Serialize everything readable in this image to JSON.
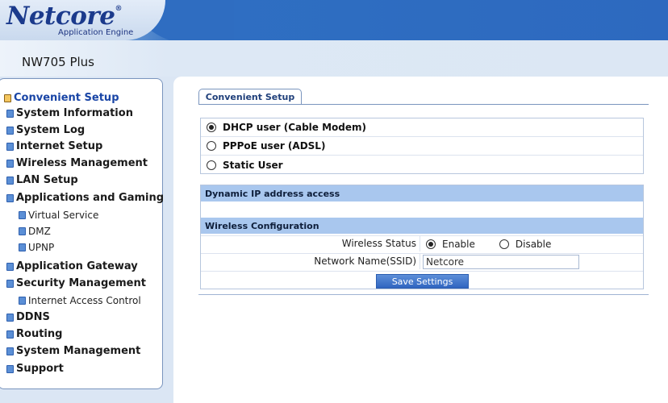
{
  "header": {
    "brand": "Netcore",
    "brand_mark": "®",
    "tagline": "Application Engine"
  },
  "device": {
    "name": "NW705 Plus"
  },
  "sidebar": {
    "items": [
      {
        "label": "Convenient Setup",
        "active": true
      },
      {
        "label": "System Information"
      },
      {
        "label": "System Log"
      },
      {
        "label": "Internet Setup"
      },
      {
        "label": "Wireless Management"
      },
      {
        "label": "LAN Setup"
      },
      {
        "label": "Applications and Gaming"
      },
      {
        "label": "Virtual Service",
        "sub": true
      },
      {
        "label": "DMZ",
        "sub": true
      },
      {
        "label": "UPNP",
        "sub": true
      },
      {
        "label": "Application Gateway"
      },
      {
        "label": "Security Management"
      },
      {
        "label": "Internet Access Control",
        "sub": true
      },
      {
        "label": "DDNS"
      },
      {
        "label": "Routing"
      },
      {
        "label": "System Management"
      },
      {
        "label": "Support"
      }
    ]
  },
  "main": {
    "tab_label": "Convenient Setup",
    "modes": [
      {
        "label": "DHCP user (Cable Modem)",
        "selected": true
      },
      {
        "label": "PPPoE user (ADSL)",
        "selected": false
      },
      {
        "label": "Static User",
        "selected": false
      }
    ],
    "dynamic_section_title": "Dynamic IP address access",
    "wireless_section_title": "Wireless Configuration",
    "wireless_status_label": "Wireless Status",
    "wireless_enable_label": "Enable",
    "wireless_disable_label": "Disable",
    "wireless_status_value": "Enable",
    "ssid_label": "Network Name(SSID)",
    "ssid_value": "Netcore",
    "save_label": "Save Settings"
  },
  "colors": {
    "header_blue": "#2d69bf",
    "nav_active": "#1945a6",
    "section_header": "#a9c7ee",
    "button_blue": "#3065c0"
  }
}
